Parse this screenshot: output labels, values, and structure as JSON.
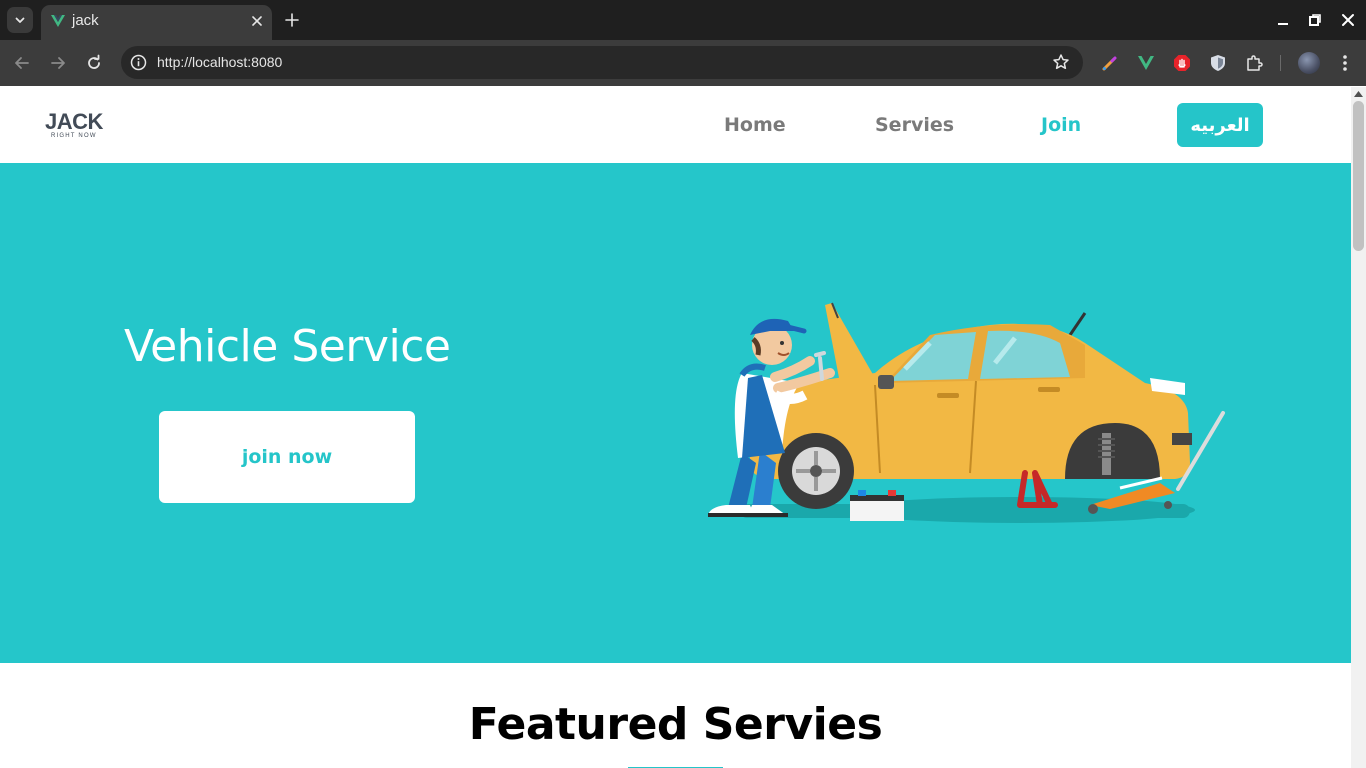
{
  "browser": {
    "tab_title": "jack",
    "url": "http://localhost:8080"
  },
  "site": {
    "logo_main": "JACK",
    "logo_sub": "RIGHT NOW",
    "nav": {
      "home": "Home",
      "services": "Servies",
      "join": "Join",
      "language": "العربيه"
    },
    "hero": {
      "title": "Vehicle Service",
      "button": "join now"
    },
    "featured_title": "Featured Servies"
  },
  "colors": {
    "accent": "#25c5c9",
    "hero_bg": "#25c6ca",
    "nav_inactive": "#7a7a7a",
    "logo": "#424b57"
  },
  "icons": {
    "tab_search": "chevron-down-icon",
    "favicon": "vue-logo-icon",
    "back": "arrow-left-icon",
    "forward": "arrow-right-icon",
    "reload": "reload-icon",
    "site_info": "info-icon",
    "bookmark": "star-icon",
    "extensions": "puzzle-icon",
    "menu": "kebab-menu-icon"
  }
}
